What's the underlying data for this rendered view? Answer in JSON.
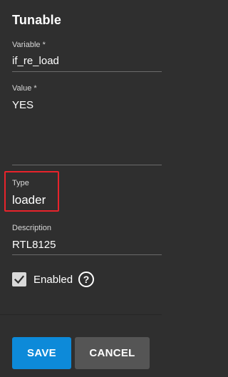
{
  "form": {
    "title": "Tunable",
    "variable": {
      "label": "Variable *",
      "value": "if_re_load"
    },
    "value_field": {
      "label": "Value *",
      "value": "YES"
    },
    "type": {
      "label": "Type",
      "value": "loader"
    },
    "description": {
      "label": "Description",
      "value": "RTL8125"
    },
    "enabled": {
      "label": "Enabled",
      "checked": true,
      "help_symbol": "?"
    }
  },
  "actions": {
    "save_label": "SAVE",
    "cancel_label": "CANCEL"
  },
  "colors": {
    "background": "#2f2f2f",
    "primary": "#0d8ad9",
    "secondary": "#555555",
    "highlight": "#e8232b"
  }
}
